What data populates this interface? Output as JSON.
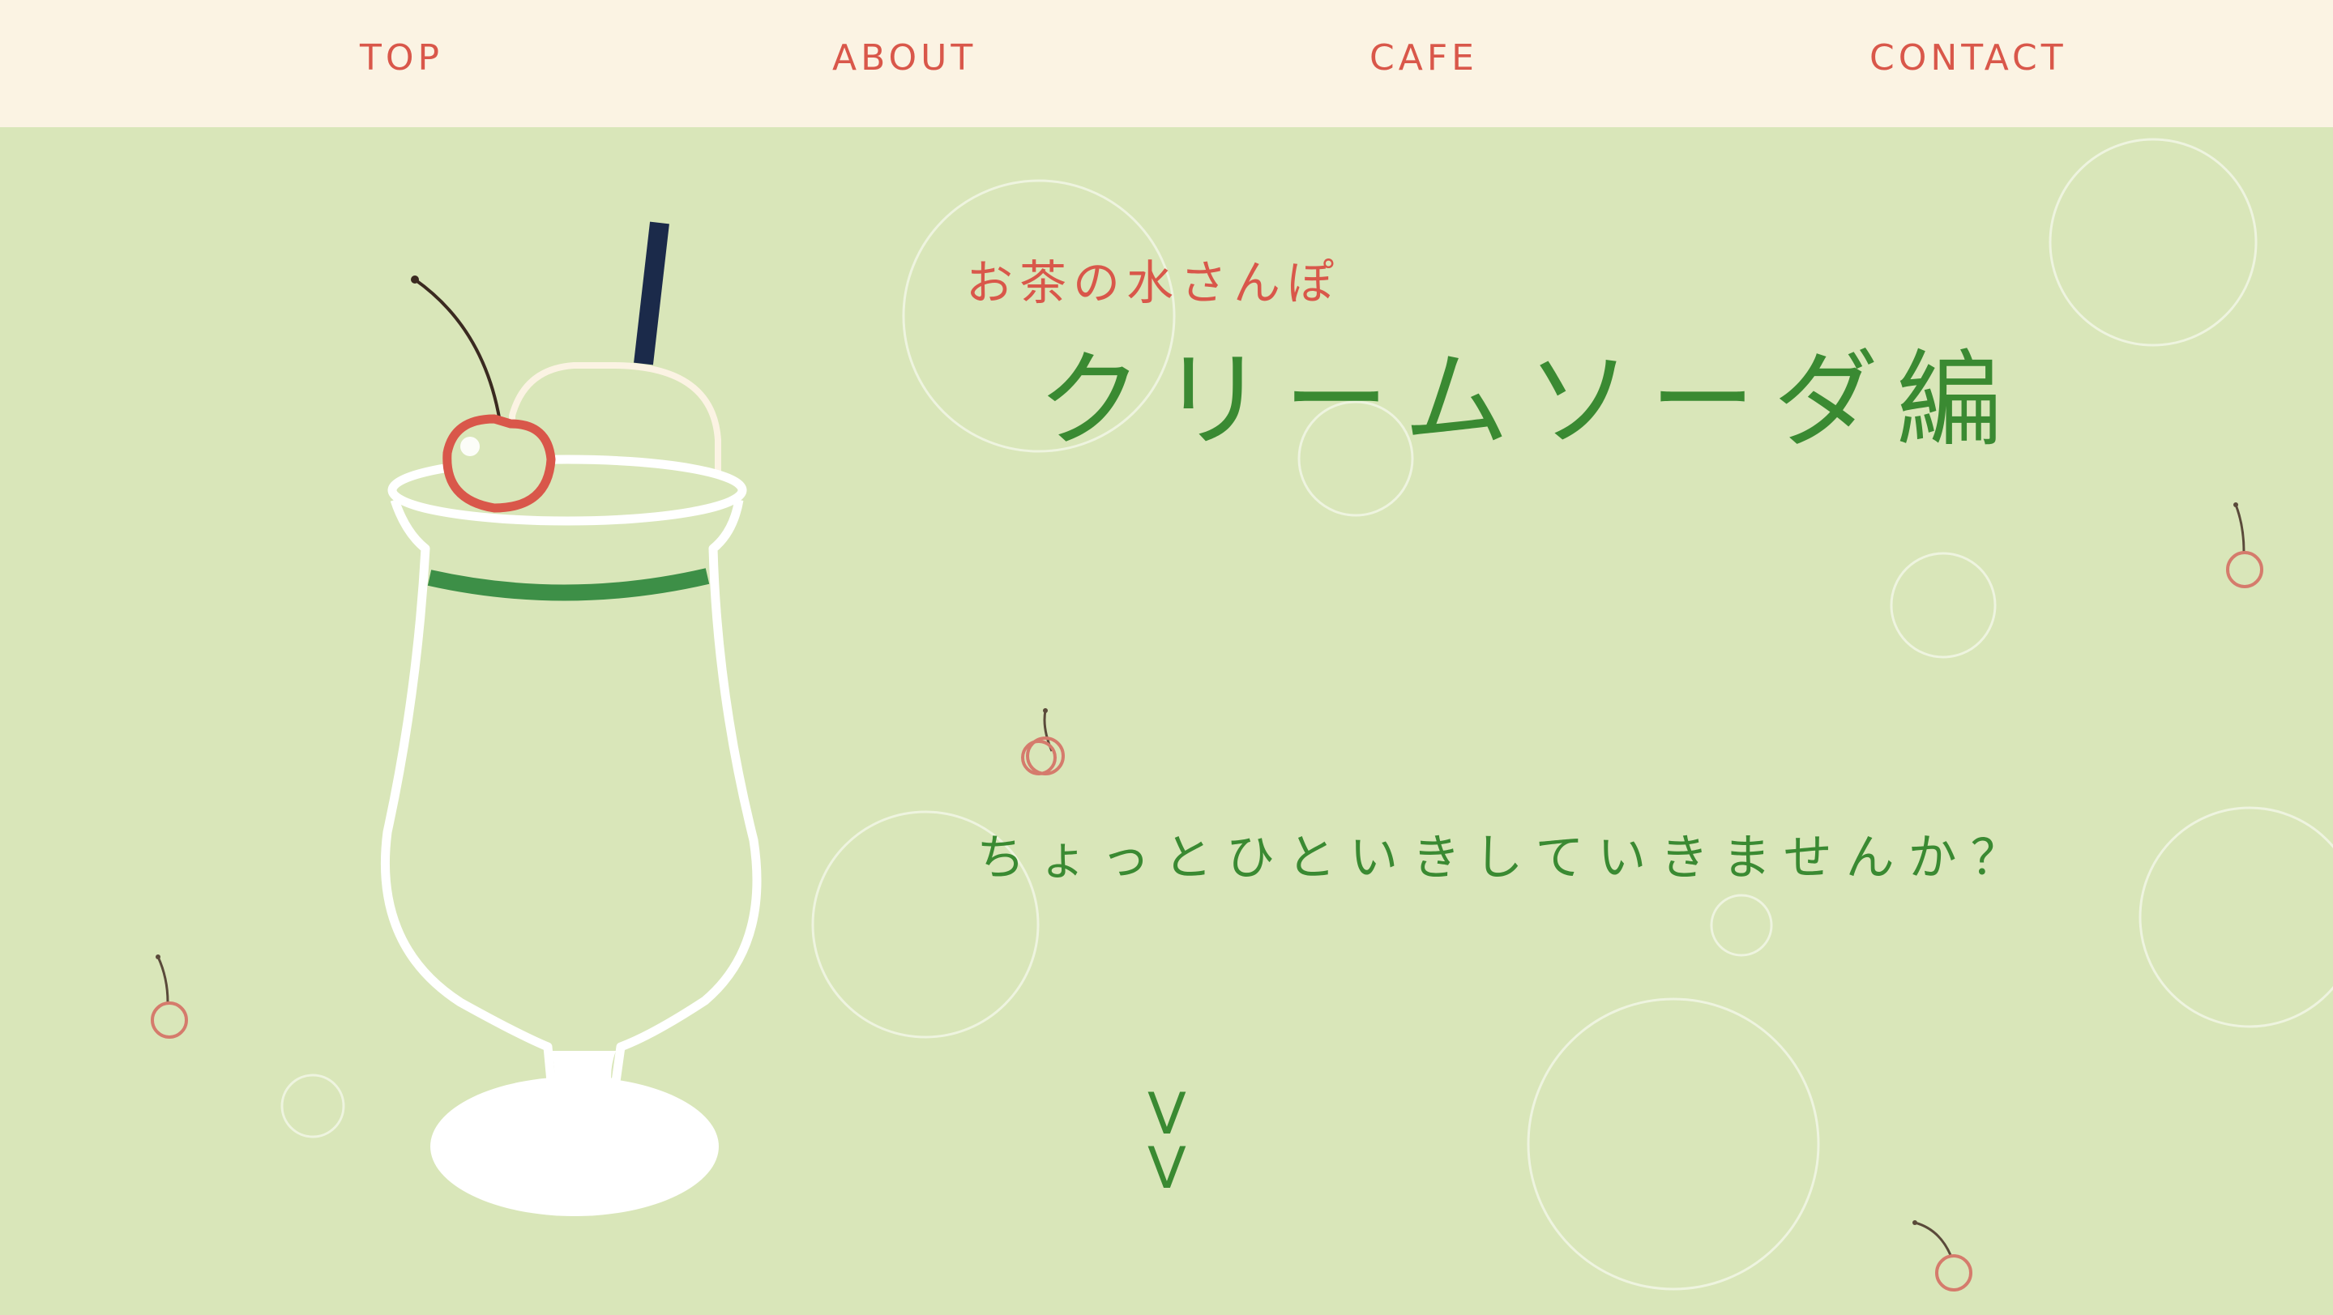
{
  "nav": {
    "top_label": "TOP",
    "about_label": "ABOUT",
    "cafe_label": "CAFE",
    "contact_label": "CONTACT"
  },
  "hero": {
    "subtitle": "お茶の水さんぽ",
    "title": "クリームソーダ編",
    "tagline": "ちょっとひといきしていきませんか？",
    "scroll_glyph": "V\nV"
  },
  "colors": {
    "nav_bg": "#fbf3e3",
    "nav_text": "#d9574a",
    "hero_bg": "#d9e6b9",
    "title_green": "#3a8a32",
    "cherry_red": "#d9574a",
    "straw_navy": "#1b2a4a"
  },
  "icons": [
    "cream-soda-glass-illustration",
    "cherry-icon",
    "bubble-circle"
  ]
}
